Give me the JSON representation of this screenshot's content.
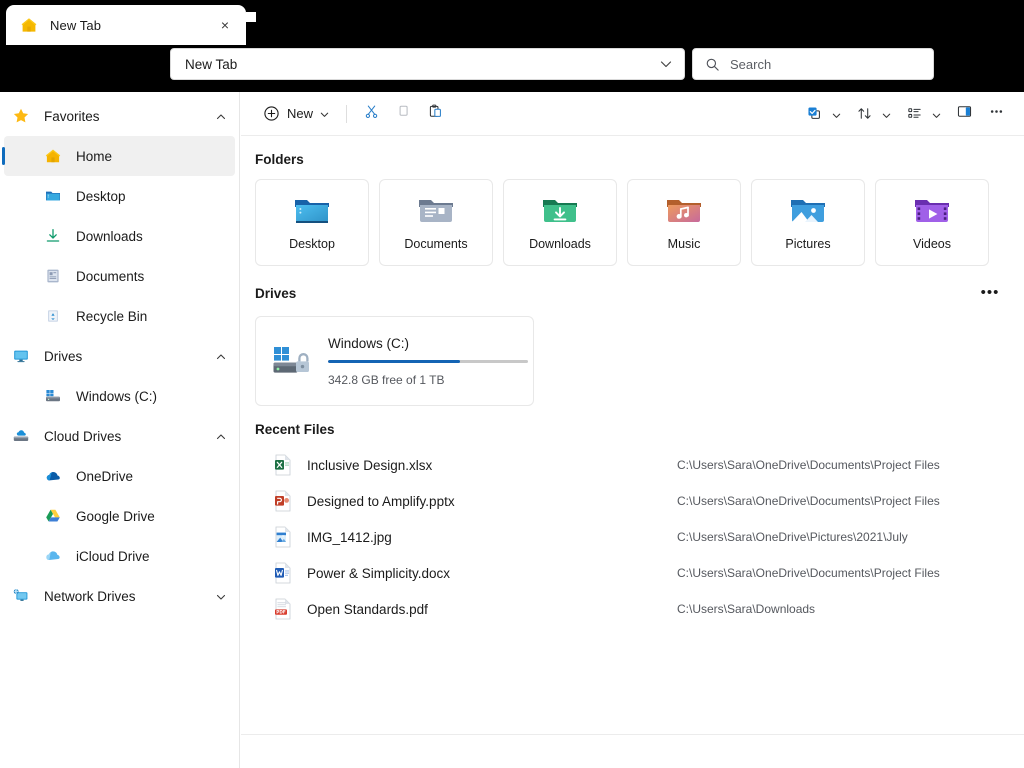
{
  "window": {
    "tab": {
      "label": "New Tab",
      "icon": "home-icon",
      "close_label": "×"
    },
    "address": {
      "value": "New Tab",
      "chevron": "chevron-down-icon"
    },
    "search": {
      "placeholder": "Search",
      "icon": "search-icon"
    }
  },
  "toolbar": {
    "new_label": "New",
    "items": [
      {
        "name": "new-button",
        "label": "New"
      },
      {
        "name": "cut-button",
        "label": "Cut"
      },
      {
        "name": "copy-button",
        "label": "Copy"
      },
      {
        "name": "paste-button",
        "label": "Paste"
      },
      {
        "name": "select-button",
        "label": "Select"
      },
      {
        "name": "sort-button",
        "label": "Sort"
      },
      {
        "name": "view-button",
        "label": "View"
      },
      {
        "name": "details-pane-button",
        "label": "Details pane"
      },
      {
        "name": "more-options-button",
        "label": "See more"
      }
    ]
  },
  "sidebar": {
    "groups": [
      {
        "label": "Favorites",
        "icon": "star-icon",
        "expanded": true,
        "chevron": "chevron-up-icon",
        "items": [
          {
            "label": "Home",
            "icon": "home-icon",
            "selected": true
          },
          {
            "label": "Desktop",
            "icon": "desktop-folder-icon",
            "selected": false
          },
          {
            "label": "Downloads",
            "icon": "downloads-icon",
            "selected": false
          },
          {
            "label": "Documents",
            "icon": "documents-icon",
            "selected": false
          },
          {
            "label": "Recycle Bin",
            "icon": "recycle-bin-icon",
            "selected": false
          }
        ]
      },
      {
        "label": "Drives",
        "icon": "monitor-icon",
        "expanded": true,
        "chevron": "chevron-up-icon",
        "items": [
          {
            "label": "Windows (C:)",
            "icon": "windows-drive-icon",
            "selected": false
          }
        ]
      },
      {
        "label": "Cloud Drives",
        "icon": "cloud-drive-icon",
        "expanded": true,
        "chevron": "chevron-up-icon",
        "items": [
          {
            "label": "OneDrive",
            "icon": "onedrive-icon",
            "selected": false
          },
          {
            "label": "Google Drive",
            "icon": "google-drive-icon",
            "selected": false
          },
          {
            "label": "iCloud Drive",
            "icon": "icloud-icon",
            "selected": false
          }
        ]
      },
      {
        "label": "Network Drives",
        "icon": "network-drive-icon",
        "expanded": false,
        "chevron": "chevron-down-icon",
        "items": []
      }
    ]
  },
  "main": {
    "folders_section": {
      "title": "Folders"
    },
    "folders": [
      {
        "label": "Desktop",
        "icon": "desktop-folder-icon"
      },
      {
        "label": "Documents",
        "icon": "documents-folder-icon"
      },
      {
        "label": "Downloads",
        "icon": "downloads-folder-icon"
      },
      {
        "label": "Music",
        "icon": "music-folder-icon"
      },
      {
        "label": "Pictures",
        "icon": "pictures-folder-icon"
      },
      {
        "label": "Videos",
        "icon": "videos-folder-icon"
      }
    ],
    "drives_section": {
      "title": "Drives",
      "more_label": "•••"
    },
    "drives": [
      {
        "name": "Windows (C:)",
        "free_text": "342.8 GB free of 1 TB",
        "used_percent": 66,
        "icon": "windows-bitlocker-drive-icon"
      }
    ],
    "recent_section": {
      "title": "Recent Files"
    },
    "recent_files": [
      {
        "name": "Inclusive Design.xlsx",
        "path": "C:\\Users\\Sara\\OneDrive\\Documents\\Project Files",
        "icon": "excel-file-icon"
      },
      {
        "name": "Designed to Amplify.pptx",
        "path": "C:\\Users\\Sara\\OneDrive\\Documents\\Project Files",
        "icon": "powerpoint-file-icon"
      },
      {
        "name": "IMG_1412.jpg",
        "path": "C:\\Users\\Sara\\OneDrive\\Pictures\\2021\\July",
        "icon": "image-file-icon"
      },
      {
        "name": "Power & Simplicity.docx",
        "path": "C:\\Users\\Sara\\OneDrive\\Documents\\Project Files",
        "icon": "word-file-icon"
      },
      {
        "name": "Open Standards.pdf",
        "path": "C:\\Users\\Sara\\Downloads",
        "icon": "pdf-file-icon"
      }
    ]
  },
  "colors": {
    "accent": "#0f6cbd",
    "drive_bar": "#1464b4",
    "tab_home": "#f5b800",
    "titlebar": "#000000"
  }
}
